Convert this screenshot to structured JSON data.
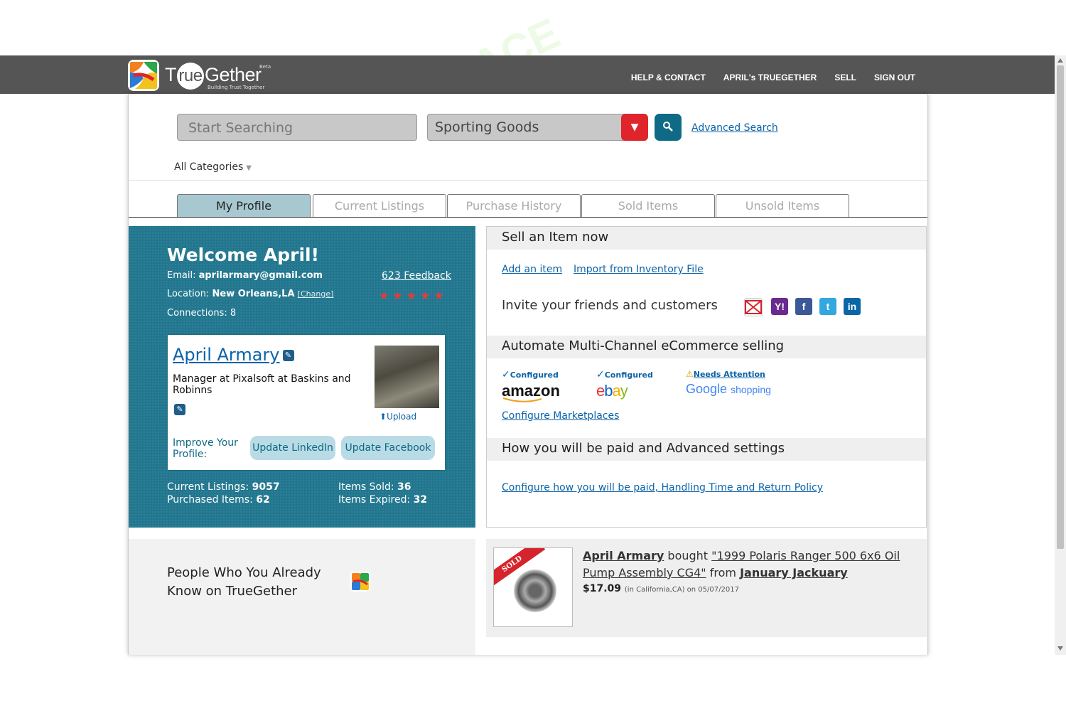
{
  "brand": {
    "name_prefix": "T",
    "name_circle": "rue",
    "name_suffix": "Gether",
    "beta": "Beta",
    "tagline": "Building Trust Together"
  },
  "nav": {
    "items": [
      "HELP & CONTACT",
      "APRIL's TRUEGETHER",
      "SELL",
      "SIGN OUT"
    ]
  },
  "search": {
    "placeholder": "Start Searching",
    "category": "Sporting Goods",
    "advanced_label": "Advanced Search",
    "all_categories": "All Categories"
  },
  "tabs": [
    {
      "label": "My Profile",
      "active": true
    },
    {
      "label": "Current Listings",
      "active": false
    },
    {
      "label": "Purchase History",
      "active": false
    },
    {
      "label": "Sold Items",
      "active": false
    },
    {
      "label": "Unsold Items",
      "active": false
    }
  ],
  "profile": {
    "welcome": "Welcome April!",
    "email_label": "Email:",
    "email": "aprilarmary@gmail.com",
    "location_label": "Location:",
    "location": "New Orleans,LA",
    "change_label": "[Change]",
    "connections_label": "Connections:",
    "connections": "8",
    "feedback_count": "623",
    "feedback_label": "Feedback",
    "stars": "★★★★★",
    "name": "April Armary",
    "title": "Manager at Pixalsoft at Baskins and Robinns",
    "upload_label": "Upload",
    "improve_label": "Improve Your Profile:",
    "update_linkedin": "Update LinkedIn",
    "update_facebook": "Update Facebook",
    "current_listings_label": "Current Listings:",
    "current_listings": "9057",
    "purchased_label": "Purchased Items:",
    "purchased": "62",
    "sold_label": "Items Sold:",
    "sold": "36",
    "expired_label": "Items Expired:",
    "expired": "32"
  },
  "sell": {
    "heading": "Sell an Item now",
    "add_item": "Add an item",
    "import": "Import from Inventory File",
    "invite": "Invite your friends and customers",
    "automate_heading": "Automate Multi-Channel eCommerce selling",
    "marketplaces": [
      {
        "status": "Configured",
        "name": "amazon"
      },
      {
        "status": "Configured",
        "name": "ebay"
      },
      {
        "status": "Needs Attention",
        "name_a": "Google",
        "name_b": "shopping"
      }
    ],
    "configure_marketplaces": "Configure Marketplaces",
    "paid_heading": "How you will be paid and Advanced settings",
    "configure_paid": "Configure how you will be paid, Handling Time and Return Policy"
  },
  "people": {
    "text_line1": "People Who You Already",
    "text_line2": "Know on TrueGether"
  },
  "activity": {
    "buyer": "April Armary",
    "verb": "bought",
    "item": "\"1999 Polaris Ranger 500 6x6 Oil Pump Assembly CG4\"",
    "from": "from",
    "seller": "January Jackuary",
    "price": "$17.09",
    "location_note": "(in California,CA) on 05/07/2017",
    "ribbon": "SOLD"
  },
  "watermark": "AI TALENT SPACE",
  "colors": {
    "header": "#555555",
    "profile_bg": "#22778f",
    "link": "#0b63a8",
    "active_tab": "#a8c8d1",
    "dropdown_red": "#e0242b"
  }
}
